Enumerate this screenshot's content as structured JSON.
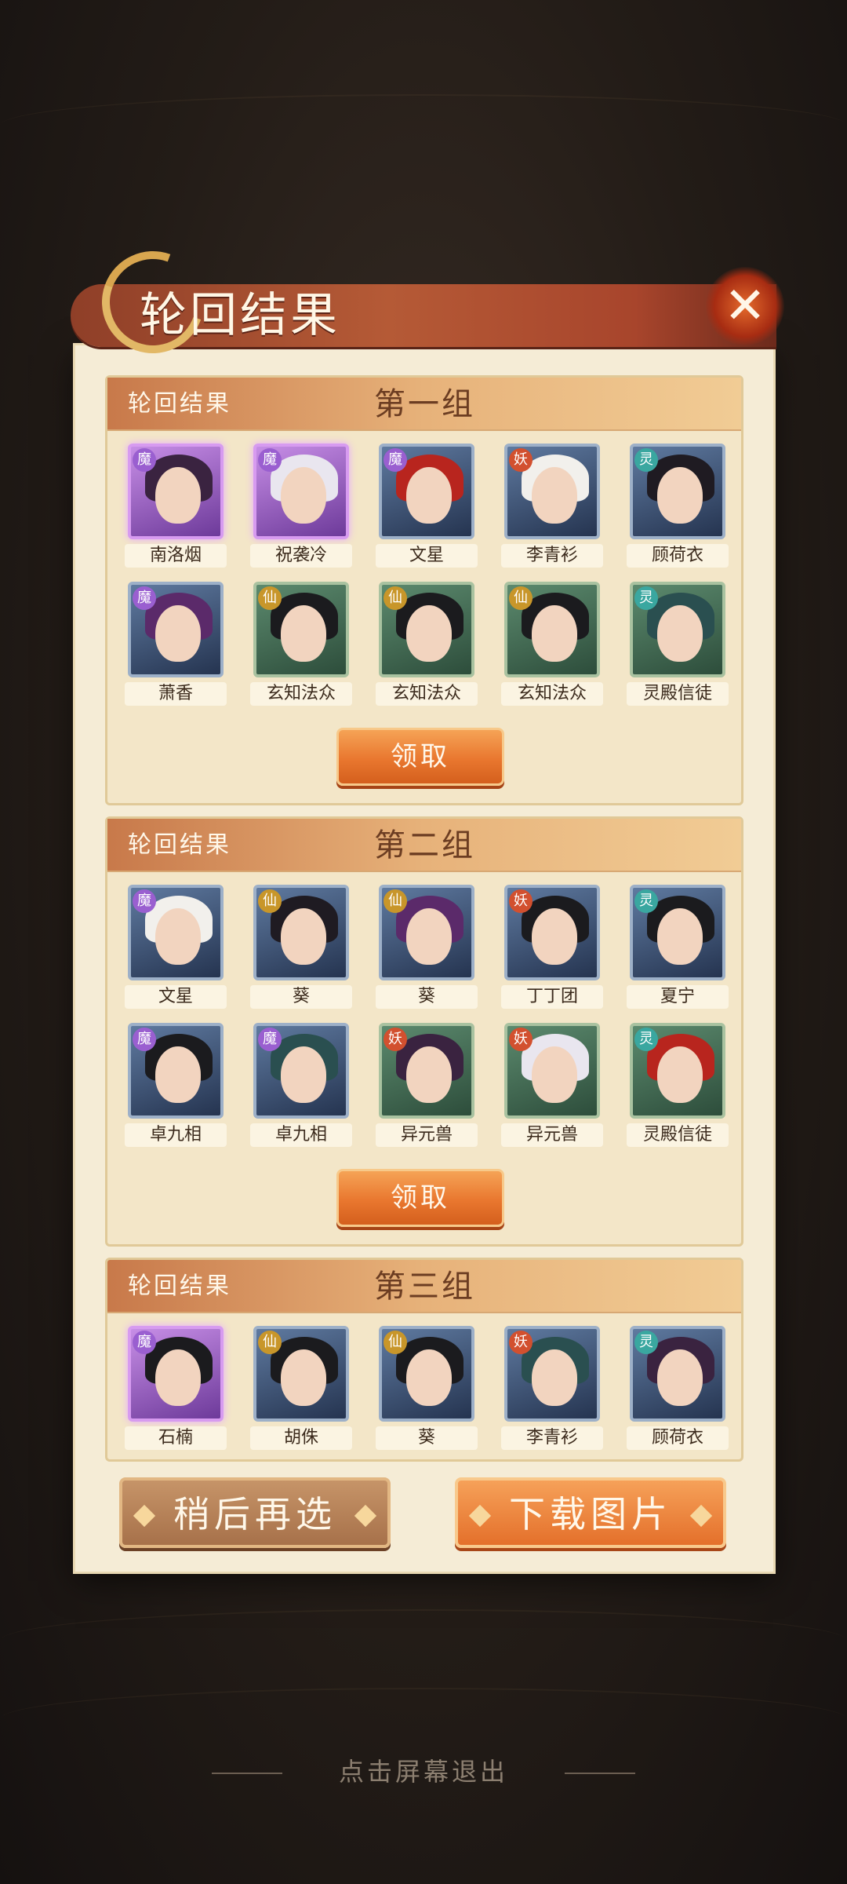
{
  "dialog": {
    "title": "轮回结果",
    "close_icon": "close-icon",
    "exit_hint": "点击屏幕退出"
  },
  "groups": [
    {
      "label": "轮回结果",
      "title": "第一组",
      "claim_label": "领取",
      "characters": [
        {
          "name": "南洛烟",
          "badge": "魔",
          "frame": "purple"
        },
        {
          "name": "祝袭冷",
          "badge": "魔",
          "frame": "purple"
        },
        {
          "name": "文星",
          "badge": "魔",
          "frame": "blue"
        },
        {
          "name": "李青衫",
          "badge": "妖",
          "frame": "blue"
        },
        {
          "name": "顾荷衣",
          "badge": "灵",
          "frame": "blue"
        },
        {
          "name": "萧香",
          "badge": "魔",
          "frame": "blue"
        },
        {
          "name": "玄知法众",
          "badge": "仙",
          "frame": "green"
        },
        {
          "name": "玄知法众",
          "badge": "仙",
          "frame": "green"
        },
        {
          "name": "玄知法众",
          "badge": "仙",
          "frame": "green"
        },
        {
          "name": "灵殿信徒",
          "badge": "灵",
          "frame": "green"
        }
      ]
    },
    {
      "label": "轮回结果",
      "title": "第二组",
      "claim_label": "领取",
      "characters": [
        {
          "name": "文星",
          "badge": "魔",
          "frame": "blue"
        },
        {
          "name": "葵",
          "badge": "仙",
          "frame": "blue"
        },
        {
          "name": "葵",
          "badge": "仙",
          "frame": "blue"
        },
        {
          "name": "丁丁团",
          "badge": "妖",
          "frame": "blue"
        },
        {
          "name": "夏宁",
          "badge": "灵",
          "frame": "blue"
        },
        {
          "name": "卓九相",
          "badge": "魔",
          "frame": "blue"
        },
        {
          "name": "卓九相",
          "badge": "魔",
          "frame": "blue"
        },
        {
          "name": "异元兽",
          "badge": "妖",
          "frame": "green"
        },
        {
          "name": "异元兽",
          "badge": "妖",
          "frame": "green"
        },
        {
          "name": "灵殿信徒",
          "badge": "灵",
          "frame": "green"
        }
      ]
    },
    {
      "label": "轮回结果",
      "title": "第三组",
      "characters": [
        {
          "name": "石楠",
          "badge": "魔",
          "frame": "purple"
        },
        {
          "name": "胡侏",
          "badge": "仙",
          "frame": "blue"
        },
        {
          "name": "葵",
          "badge": "仙",
          "frame": "blue"
        },
        {
          "name": "李青衫",
          "badge": "妖",
          "frame": "blue"
        },
        {
          "name": "顾荷衣",
          "badge": "灵",
          "frame": "blue"
        }
      ]
    }
  ],
  "footer": {
    "later_label": "稍后再选",
    "download_label": "下载图片"
  },
  "colors": {
    "badge_mo": "#9a5fd0",
    "badge_yao": "#d2502f",
    "badge_ling": "#3aa7a0",
    "badge_xian": "#c8962a"
  }
}
